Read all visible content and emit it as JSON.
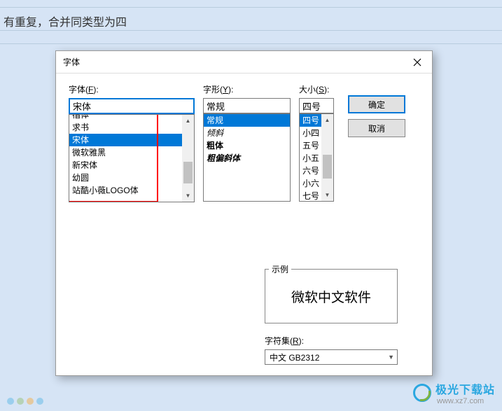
{
  "background": {
    "text": "有重复，合并同类型为四"
  },
  "dialog": {
    "title": "字体",
    "labels": {
      "font": "字体(",
      "font_key": "F",
      "font_suffix": "):",
      "style": "字形(",
      "style_key": "Y",
      "style_suffix": "):",
      "size": "大小(",
      "size_key": "S",
      "size_suffix": "):",
      "sample": "示例",
      "charset": "字符集(",
      "charset_key": "R",
      "charset_suffix": "):"
    },
    "font": {
      "value": "宋体",
      "items": [
        "楷体",
        "求书",
        "宋体",
        "微软雅黑",
        "新宋体",
        "幼圆",
        "站酷小薇LOGO体"
      ],
      "selected_index": 2
    },
    "style": {
      "value": "常规",
      "items": [
        "常规",
        "倾斜",
        "粗体",
        "粗偏斜体"
      ],
      "selected_index": 0
    },
    "size": {
      "value": "四号",
      "items": [
        "四号",
        "小四",
        "五号",
        "小五",
        "六号",
        "小六",
        "七号"
      ],
      "selected_index": 0
    },
    "buttons": {
      "ok": "确定",
      "cancel": "取消"
    },
    "sample_text": "微软中文软件",
    "charset_value": "中文 GB2312"
  },
  "watermark": {
    "brand": "极光下载站",
    "url": "www.xz7.com"
  }
}
